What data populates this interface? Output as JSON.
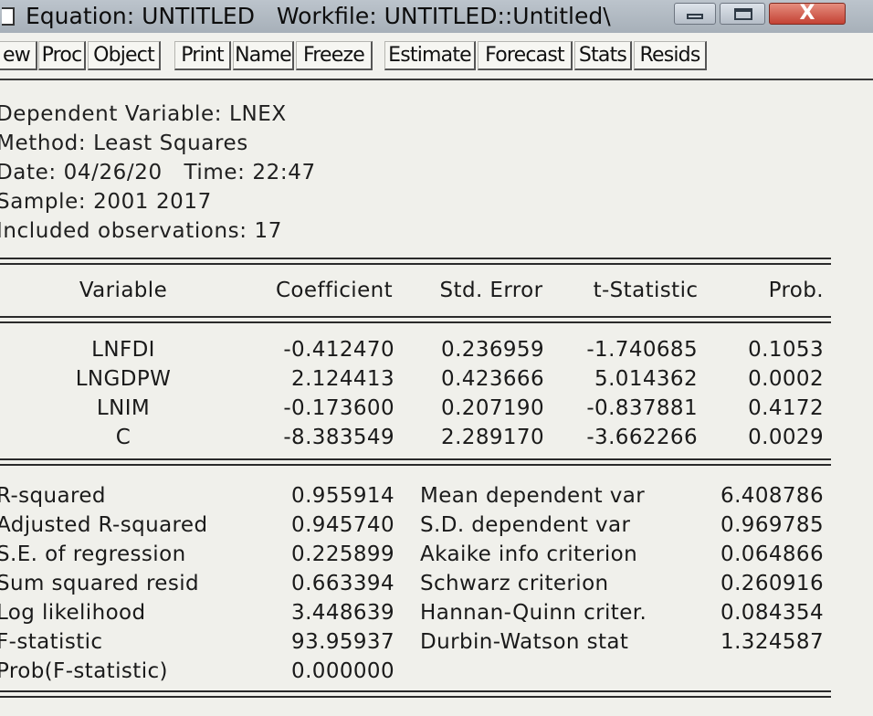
{
  "window": {
    "title": "Equation: UNTITLED   Workfile: UNTITLED::Untitled\\",
    "controls": {
      "close_glyph": "X"
    }
  },
  "toolbar": {
    "buttons": [
      "ew",
      "Proc",
      "Object",
      "Print",
      "Name",
      "Freeze",
      "Estimate",
      "Forecast",
      "Stats",
      "Resids"
    ]
  },
  "header": {
    "lines": [
      "Dependent Variable: LNEX",
      "Method: Least Squares",
      "Date: 04/26/20   Time: 22:47",
      "Sample: 2001 2017",
      "Included observations: 17"
    ]
  },
  "coef_table": {
    "columns": [
      "Variable",
      "Coefficient",
      "Std. Error",
      "t-Statistic",
      "Prob."
    ],
    "rows": [
      [
        "LNFDI",
        "-0.412470",
        "0.236959",
        "-1.740685",
        "0.1053"
      ],
      [
        "LNGDPW",
        "2.124413",
        "0.423666",
        "5.014362",
        "0.0002"
      ],
      [
        "LNIM",
        "-0.173600",
        "0.207190",
        "-0.837881",
        "0.4172"
      ],
      [
        "C",
        "-8.383549",
        "2.289170",
        "-3.662266",
        "0.0029"
      ]
    ]
  },
  "stats": {
    "left": [
      [
        "R-squared",
        "0.955914"
      ],
      [
        "Adjusted R-squared",
        "0.945740"
      ],
      [
        "S.E. of regression",
        "0.225899"
      ],
      [
        "Sum squared resid",
        "0.663394"
      ],
      [
        "Log likelihood",
        "3.448639"
      ],
      [
        "F-statistic",
        "93.95937"
      ],
      [
        "Prob(F-statistic)",
        "0.000000"
      ]
    ],
    "right": [
      [
        "Mean dependent var",
        "6.408786"
      ],
      [
        "S.D. dependent var",
        "0.969785"
      ],
      [
        "Akaike info criterion",
        "0.064866"
      ],
      [
        "Schwarz criterion",
        "0.260916"
      ],
      [
        "Hannan-Quinn criter.",
        "0.084354"
      ],
      [
        "Durbin-Watson stat",
        "1.324587"
      ]
    ]
  }
}
